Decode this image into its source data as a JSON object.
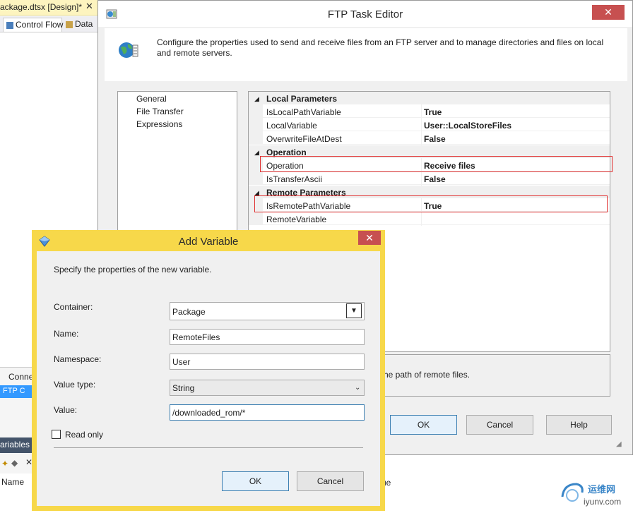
{
  "vs": {
    "tab_title": "ackage.dtsx [Design]*",
    "tab_close": "✕",
    "doc_tabs": [
      "Control Flow",
      "Data"
    ],
    "connections_header": "Conne",
    "connection_item": "FTP C",
    "variables_panel_title": "ariables",
    "variables_col_name": "Name",
    "variables_col_value": "ue"
  },
  "ftp_editor": {
    "title": "FTP Task Editor",
    "close_glyph": "✕",
    "description": "Configure the properties used to send and receive files from an FTP server and to manage directories and files on local and remote servers.",
    "nav": [
      "General",
      "File Transfer",
      "Expressions"
    ],
    "categories": [
      {
        "label": "Local Parameters",
        "rows": [
          {
            "name": "IsLocalPathVariable",
            "value": "True"
          },
          {
            "name": "LocalVariable",
            "value": "User::LocalStoreFiles"
          },
          {
            "name": "OverwriteFileAtDest",
            "value": "False"
          }
        ]
      },
      {
        "label": "Operation",
        "rows": [
          {
            "name": "Operation",
            "value": "Receive files"
          },
          {
            "name": "IsTransferAscii",
            "value": "False"
          }
        ]
      },
      {
        "label": "Remote Parameters",
        "rows": [
          {
            "name": "IsRemotePathVariable",
            "value": "True"
          },
          {
            "name": "RemoteVariable",
            "value": ""
          }
        ]
      }
    ],
    "help_text": "he path of remote files.",
    "buttons": {
      "ok": "OK",
      "cancel": "Cancel",
      "help": "Help"
    },
    "highlight_color": "#e03030"
  },
  "add_variable": {
    "title": "Add Variable",
    "close_glyph": "✕",
    "intro": "Specify the properties of the new variable.",
    "container_label": "Container:",
    "container_value": "Package",
    "name_label": "Name:",
    "name_value": "RemoteFiles",
    "namespace_label": "Namespace:",
    "namespace_value": "User",
    "value_type_label": "Value type:",
    "value_type_value": "String",
    "value_label": "Value:",
    "value_value": "/downloaded_rom/*",
    "read_only_label": "Read only",
    "read_only_checked": false,
    "buttons": {
      "ok": "OK",
      "cancel": "Cancel"
    },
    "frame_color": "#f7d84a"
  },
  "watermark": {
    "cn": "运维网",
    "site": "iyunv.com"
  }
}
